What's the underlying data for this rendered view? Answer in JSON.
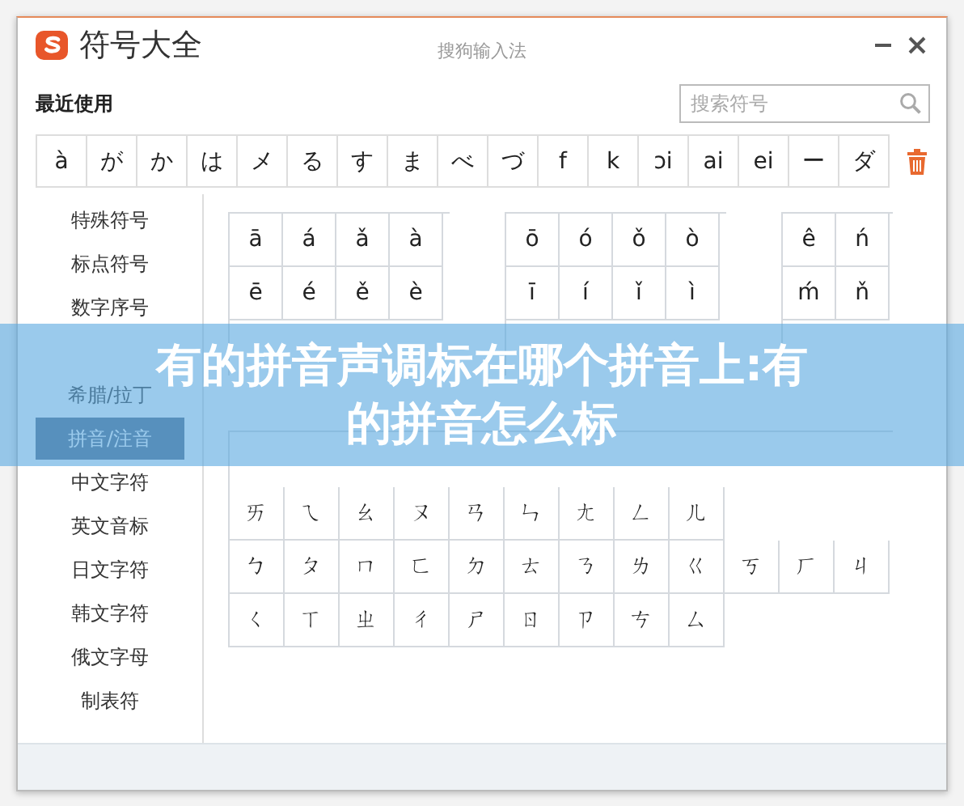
{
  "window": {
    "app_name": "符号大全",
    "title": "搜狗输入法"
  },
  "recent": {
    "label": "最近使用",
    "search": {
      "placeholder": "搜索符号"
    },
    "symbols": [
      "à",
      "が",
      "か",
      "は",
      "メ",
      "る",
      "す",
      "ま",
      "べ",
      "づ",
      "f",
      "k",
      "ɔi",
      "ai",
      "ei",
      "ー",
      "ダ"
    ]
  },
  "sidebar": {
    "items": [
      {
        "kind": "item",
        "label": "特殊符号",
        "selected": false
      },
      {
        "kind": "item",
        "label": "标点符号",
        "selected": false
      },
      {
        "kind": "item",
        "label": "数字序号",
        "selected": false
      },
      {
        "kind": "covered"
      },
      {
        "kind": "item",
        "label": "希腊/拉丁",
        "selected": false
      },
      {
        "kind": "item",
        "label": "拼音/注音",
        "selected": true
      },
      {
        "kind": "item",
        "label": "中文字符",
        "selected": false
      },
      {
        "kind": "item",
        "label": "英文音标",
        "selected": false
      },
      {
        "kind": "item",
        "label": "日文字符",
        "selected": false
      },
      {
        "kind": "item",
        "label": "韩文字符",
        "selected": false
      },
      {
        "kind": "item",
        "label": "俄文字母",
        "selected": false
      },
      {
        "kind": "item",
        "label": "制表符",
        "selected": false
      }
    ]
  },
  "tone_groups": [
    {
      "rows": [
        {
          "kind": "symbols",
          "cells": [
            "ā",
            "á",
            "ǎ",
            "à"
          ]
        },
        {
          "kind": "symbols",
          "cells": [
            "ē",
            "é",
            "ě",
            "è"
          ]
        },
        {
          "kind": "covered"
        }
      ]
    },
    {
      "rows": [
        {
          "kind": "symbols",
          "cells": [
            "ō",
            "ó",
            "ǒ",
            "ò"
          ]
        },
        {
          "kind": "symbols",
          "cells": [
            "ī",
            "í",
            "ǐ",
            "ì"
          ]
        },
        {
          "kind": "covered"
        }
      ]
    },
    {
      "rows": [
        {
          "kind": "symbols",
          "cells": [
            "ê",
            "ń"
          ]
        },
        {
          "kind": "symbols",
          "cells": [
            "ḿ",
            "ň"
          ]
        },
        {
          "kind": "covered"
        }
      ]
    }
  ],
  "zhuyin": {
    "rows": [
      {
        "kind": "covered"
      },
      {
        "kind": "symbols",
        "cells": [
          "ㄞ",
          "ㄟ",
          "ㄠ",
          "ㄡ",
          "ㄢ",
          "ㄣ",
          "ㄤ",
          "ㄥ",
          "ㄦ"
        ]
      },
      {
        "kind": "symbols",
        "cells": [
          "ㄅ",
          "ㄆ",
          "ㄇ",
          "ㄈ",
          "ㄉ",
          "ㄊ",
          "ㄋ",
          "ㄌ",
          "ㄍ",
          "ㄎ",
          "ㄏ",
          "ㄐ"
        ]
      },
      {
        "kind": "symbols",
        "cells": [
          "ㄑ",
          "ㄒ",
          "ㄓ",
          "ㄔ",
          "ㄕ",
          "ㄖ",
          "ㄗ",
          "ㄘ",
          "ㄙ"
        ]
      }
    ]
  },
  "banner": {
    "lines": [
      "有的拼音声调标在哪个拼音上:有",
      "的拼音怎么标"
    ]
  }
}
